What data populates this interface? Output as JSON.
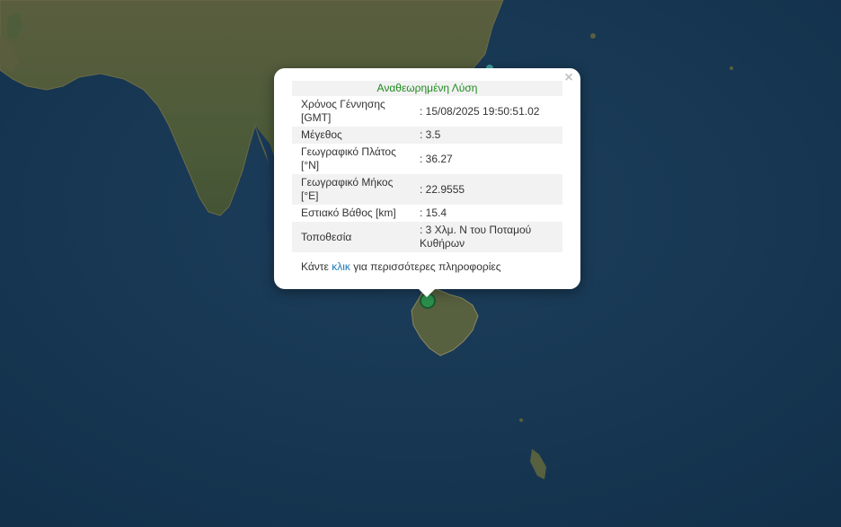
{
  "popup": {
    "header": "Αναθεωρημένη Λύση",
    "rows": [
      {
        "label": "Χρόνος Γέννησης [GMT]",
        "value": ": 15/08/2025 19:50:51.02"
      },
      {
        "label": "Μέγεθος",
        "value": ": 3.5"
      },
      {
        "label": "Γεωγραφικό Πλάτος [°N]",
        "value": ": 36.27"
      },
      {
        "label": "Γεωγραφικό Μήκος [°E]",
        "value": ": 22.9555"
      },
      {
        "label": "Εστιακό Βάθος [km]",
        "value": ": 15.4"
      },
      {
        "label": "Τοποθεσία",
        "value": ": 3 Χλμ. Ν του Ποταμού Κυθήρων"
      }
    ],
    "more_prefix": "Κάντε ",
    "more_link": "κλικ",
    "more_suffix": " για περισσότερες πληροφορίες",
    "close_glyph": "×"
  },
  "colors": {
    "sea": "#173650",
    "land": "#4e5e3c",
    "marker": "#2a8f4c",
    "header_text": "#1e8a1e",
    "link": "#1a7ab8"
  }
}
